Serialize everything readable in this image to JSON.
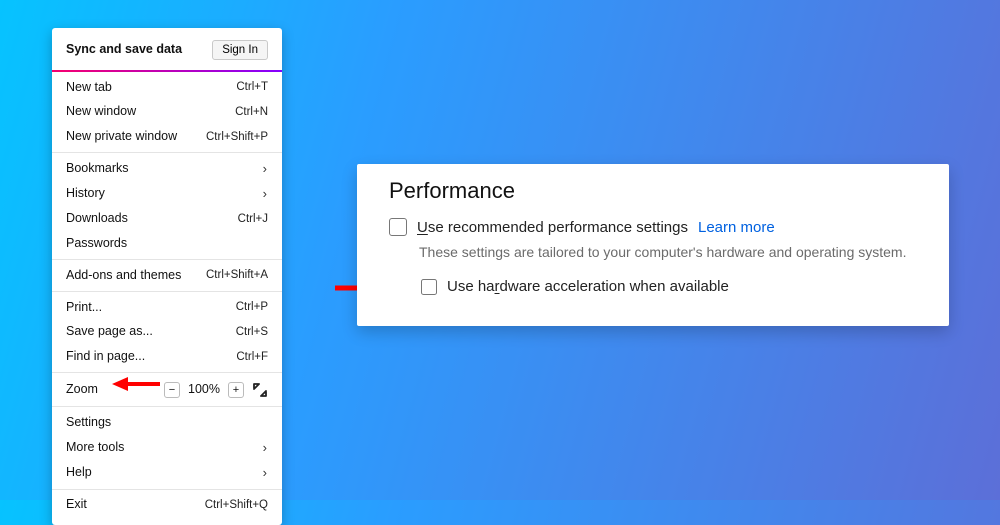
{
  "menu": {
    "sync": "Sync and save data",
    "signin": "Sign In",
    "items_a": [
      {
        "label": "New tab",
        "acc": "Ctrl+T"
      },
      {
        "label": "New window",
        "acc": "Ctrl+N"
      },
      {
        "label": "New private window",
        "acc": "Ctrl+Shift+P"
      }
    ],
    "items_b": [
      {
        "label": "Bookmarks",
        "acc": ">"
      },
      {
        "label": "History",
        "acc": ">"
      },
      {
        "label": "Downloads",
        "acc": "Ctrl+J"
      },
      {
        "label": "Passwords",
        "acc": ""
      }
    ],
    "addons": {
      "label": "Add-ons and themes",
      "acc": "Ctrl+Shift+A"
    },
    "items_c": [
      {
        "label": "Print...",
        "acc": "Ctrl+P"
      },
      {
        "label": "Save page as...",
        "acc": "Ctrl+S"
      },
      {
        "label": "Find in page...",
        "acc": "Ctrl+F"
      }
    ],
    "zoom": {
      "label": "Zoom",
      "value": "100%"
    },
    "settings": "Settings",
    "moretools": "More tools",
    "help": "Help",
    "exit": {
      "label": "Exit",
      "acc": "Ctrl+Shift+Q"
    }
  },
  "panel": {
    "title": "Performance",
    "opt1_pre": "U",
    "opt1_rest": "se recommended performance settings",
    "learn": "Learn more",
    "desc": "These settings are tailored to your computer's hardware and operating system.",
    "opt2_pre": "Use ha",
    "opt2_ul": "r",
    "opt2_rest": "dware acceleration when available"
  }
}
